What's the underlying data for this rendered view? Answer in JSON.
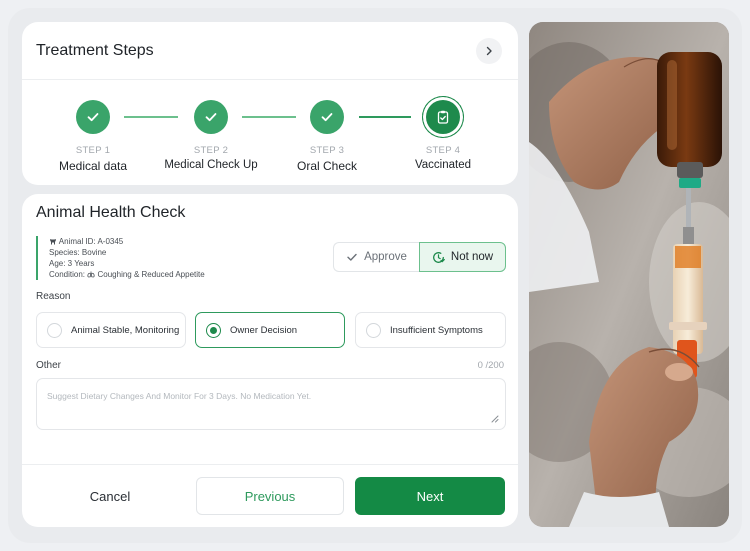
{
  "steps_card": {
    "title": "Treatment Steps",
    "steps": [
      {
        "num": "STEP 1",
        "label": "Medical data"
      },
      {
        "num": "STEP 2",
        "label": "Medical Check Up"
      },
      {
        "num": "STEP 3",
        "label": "Oral Check"
      },
      {
        "num": "STEP 4",
        "label": "Vaccinated"
      }
    ]
  },
  "health_card": {
    "title": "Animal Health Check",
    "animal_id": "Animal ID: A-0345",
    "species": "Species: Bovine",
    "age": "Age: 3 Years",
    "condition_label": "Condition:",
    "condition_value": "Coughing & Reduced Appetite",
    "approve_label": "Approve",
    "not_now_label": "Not now",
    "reason_label": "Reason",
    "reasons": [
      "Animal Stable, Monitoring",
      "Owner Decision",
      "Insufficient Symptoms"
    ],
    "selected_reason": "Owner Decision",
    "other_label": "Other",
    "counter": "0 /200",
    "other_placeholder": "Suggest Dietary Changes And Monitor For 3 Days. No Medication Yet."
  },
  "footer": {
    "cancel_label": "Cancel",
    "previous_label": "Previous",
    "next_label": "Next"
  },
  "colors": {
    "accent": "#148a45",
    "accent_light": "#3aa46a",
    "selected_bg": "#e9f6ee"
  },
  "icons": [
    "chevron-right-icon",
    "check-icon",
    "clipboard-check-icon",
    "cow-icon",
    "lungs-icon",
    "clock-check-icon",
    "resize-handle-icon"
  ]
}
